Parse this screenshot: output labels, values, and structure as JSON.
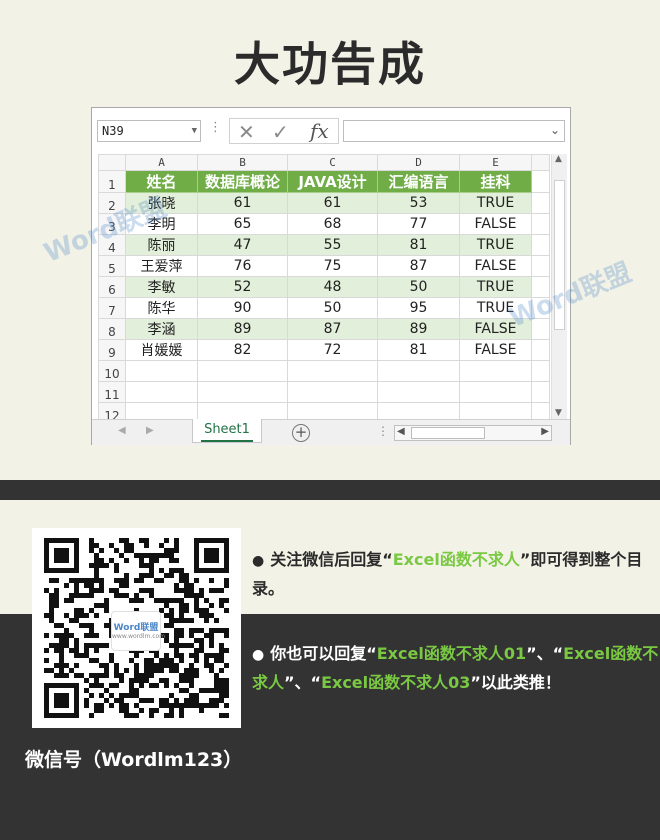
{
  "page": {
    "title": "大功告成"
  },
  "excel": {
    "name_box": "N39",
    "columns": [
      "A",
      "B",
      "C",
      "D",
      "E"
    ],
    "row_numbers": [
      "1",
      "2",
      "3",
      "4",
      "5",
      "6",
      "7",
      "8",
      "9",
      "10",
      "11",
      "12"
    ],
    "header": [
      "姓名",
      "数据库概论",
      "JAVA设计",
      "汇编语言",
      "挂科"
    ],
    "rows": [
      [
        "张晓",
        "61",
        "61",
        "53",
        "TRUE"
      ],
      [
        "李明",
        "65",
        "68",
        "77",
        "FALSE"
      ],
      [
        "陈丽",
        "47",
        "55",
        "81",
        "TRUE"
      ],
      [
        "王爱萍",
        "76",
        "75",
        "87",
        "FALSE"
      ],
      [
        "李敏",
        "52",
        "48",
        "50",
        "TRUE"
      ],
      [
        "陈华",
        "90",
        "50",
        "95",
        "TRUE"
      ],
      [
        "李涵",
        "89",
        "87",
        "89",
        "FALSE"
      ],
      [
        "肖媛媛",
        "82",
        "72",
        "81",
        "FALSE"
      ]
    ],
    "sheet_tab": "Sheet1",
    "header_color": "#70ad47",
    "band_color": "#e2efda"
  },
  "watermark": {
    "text": "Word联盟"
  },
  "qr": {
    "logo_text": "Word联盟",
    "logo_sub": "www.wordlm.com"
  },
  "wechat": {
    "id_label": "微信号（Wordlm123）"
  },
  "tips": {
    "t1_pre": "关注微信后回复“",
    "t1_key": "Excel函数不求人",
    "t1_post": "”即可得到整个目录。",
    "t2_pre": "你也可以回复“",
    "t2_key1": "Excel函数不求人01",
    "t2_mid1": "”、“",
    "t2_key2": "Excel函数不求人",
    "t2_mid2": "”、“",
    "t2_key3": "Excel函数不求人03",
    "t2_post": "”以此类推！"
  }
}
